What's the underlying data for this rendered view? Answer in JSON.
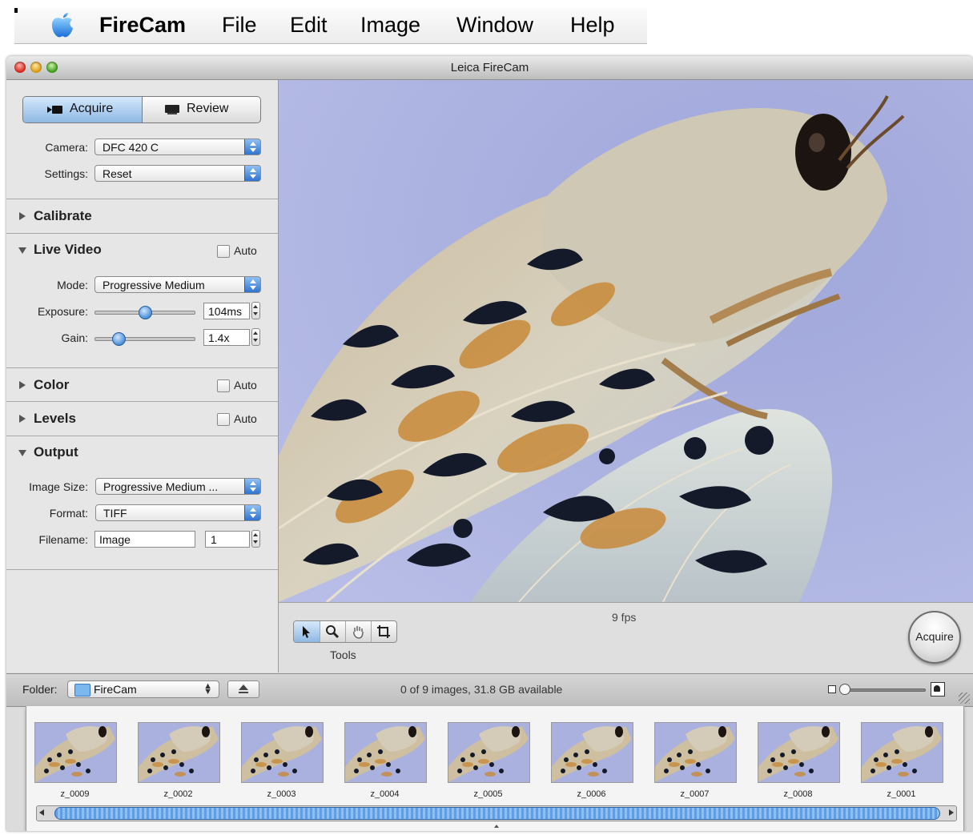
{
  "menubar": {
    "app": "FireCam",
    "items": [
      "File",
      "Edit",
      "Image",
      "Window",
      "Help"
    ]
  },
  "window": {
    "title": "Leica FireCam"
  },
  "sidebar": {
    "modes": {
      "acquire": "Acquire",
      "review": "Review",
      "selected": "Acquire"
    },
    "camera": {
      "label": "Camera:",
      "value": "DFC 420 C"
    },
    "settings": {
      "label": "Settings:",
      "value": "Reset"
    },
    "sections": {
      "calibrate": {
        "title": "Calibrate"
      },
      "live_video": {
        "title": "Live Video",
        "auto_label": "Auto",
        "mode_label": "Mode:",
        "mode_value": "Progressive Medium",
        "exposure_label": "Exposure:",
        "exposure_value": "104ms",
        "exposure_level": 0.5,
        "gain_label": "Gain:",
        "gain_value": "1.4x",
        "gain_level": 0.2
      },
      "color": {
        "title": "Color",
        "auto_label": "Auto"
      },
      "levels": {
        "title": "Levels",
        "auto_label": "Auto"
      },
      "output": {
        "title": "Output",
        "image_size_label": "Image Size:",
        "image_size_value": "Progressive Medium ...",
        "format_label": "Format:",
        "format_value": "TIFF",
        "filename_label": "Filename:",
        "filename_value": "Image",
        "counter_value": "1"
      }
    }
  },
  "viewer": {
    "fps": "9 fps",
    "tools_label": "Tools",
    "tools": [
      "arrow-tool",
      "zoom-tool",
      "hand-tool",
      "crop-tool"
    ],
    "acquire_button": "Acquire"
  },
  "folderbar": {
    "label": "Folder:",
    "folder": "FireCam",
    "status": "0 of 9 images, 31.8 GB available"
  },
  "thumbnails": [
    "z_0009",
    "z_0002",
    "z_0003",
    "z_0004",
    "z_0005",
    "z_0006",
    "z_0007",
    "z_0008",
    "z_0001"
  ],
  "colors": {
    "accent": "#3a7ed6",
    "background_lavender": "#aab1de"
  }
}
